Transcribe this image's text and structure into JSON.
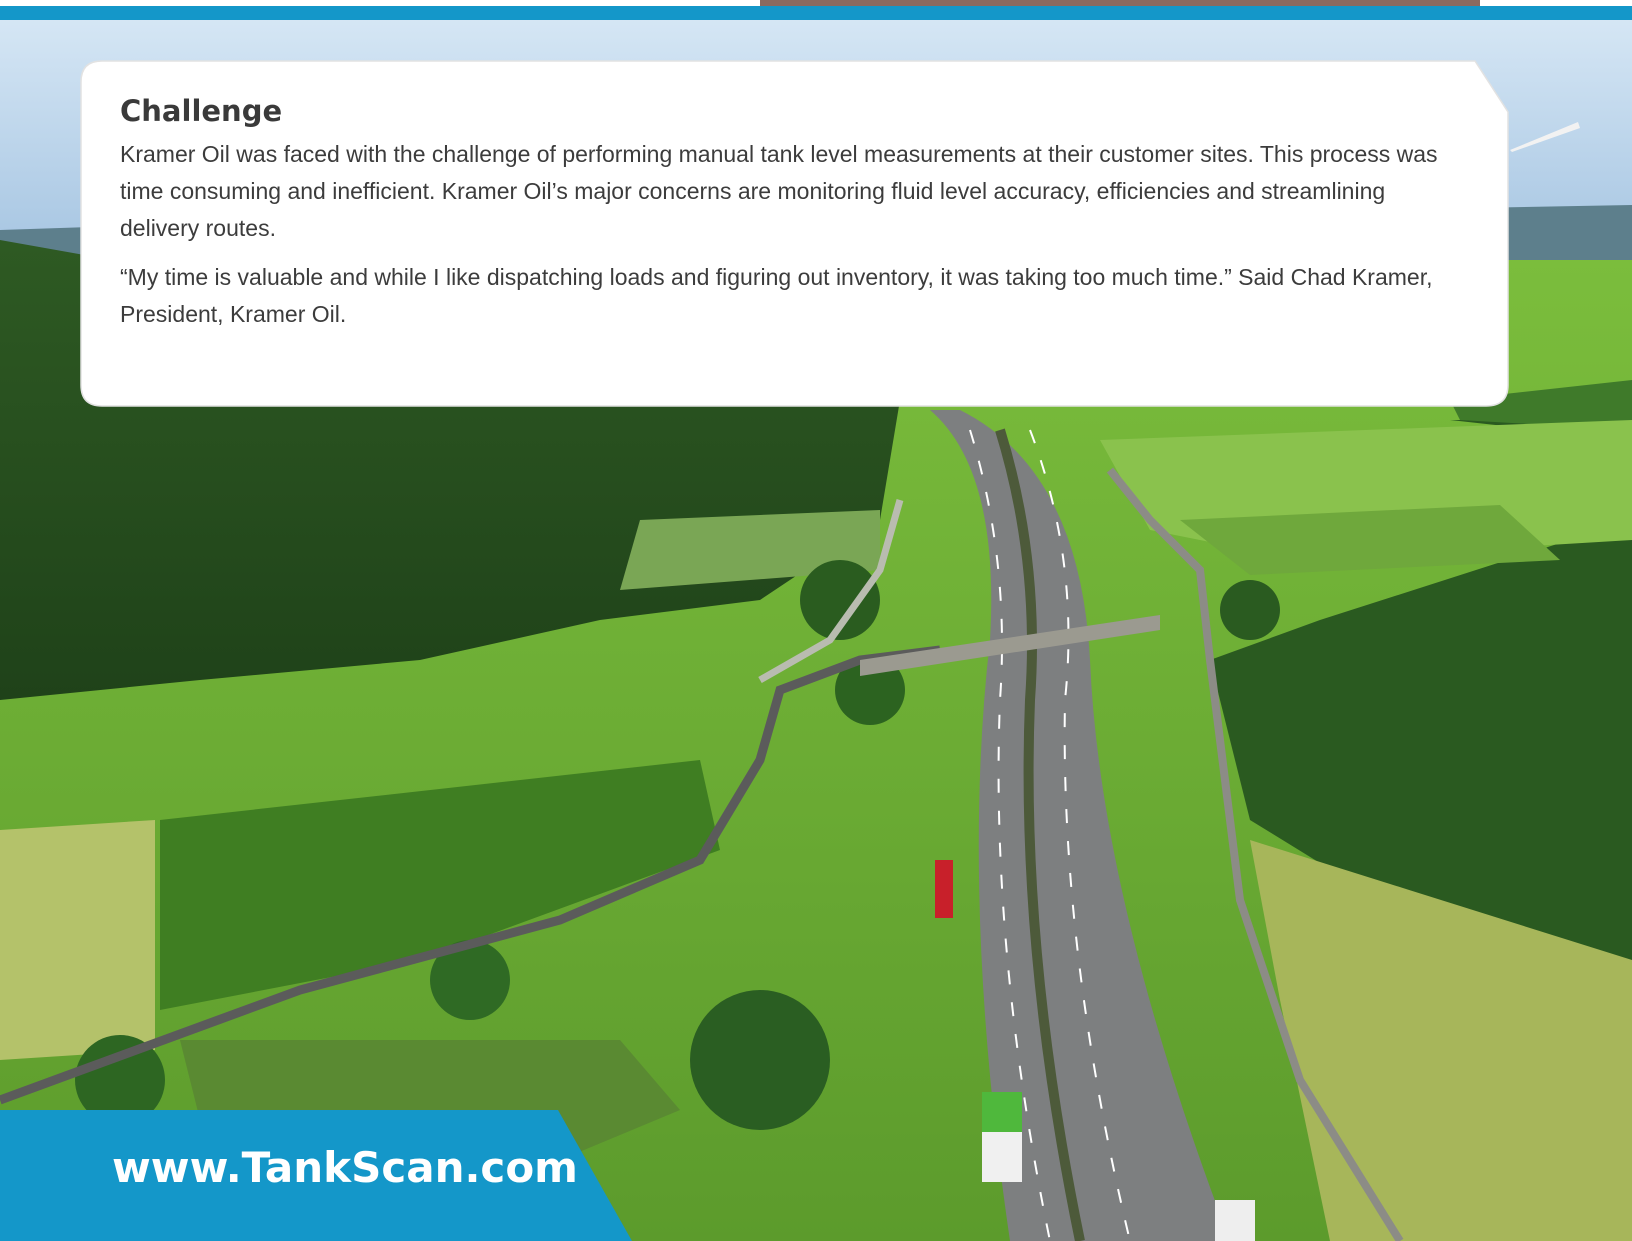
{
  "card": {
    "title": "Challenge",
    "paragraph1": "Kramer Oil was faced with the challenge of performing manual tank level measurements at their customer sites. This process was time consuming and inefficient. Kramer Oil’s major concerns are monitoring fluid level accuracy, efficiencies and streamlining delivery routes.",
    "paragraph2": "“My time is valuable and while I like dispatching loads and figuring out inventory, it was taking too much time.” Said Chad Kramer, President, Kramer Oil."
  },
  "footer": {
    "url": "www.TankScan.com"
  },
  "colors": {
    "brand_blue": "#1497c9",
    "card_background": "#ffffff",
    "text": "#3a3a3a"
  }
}
